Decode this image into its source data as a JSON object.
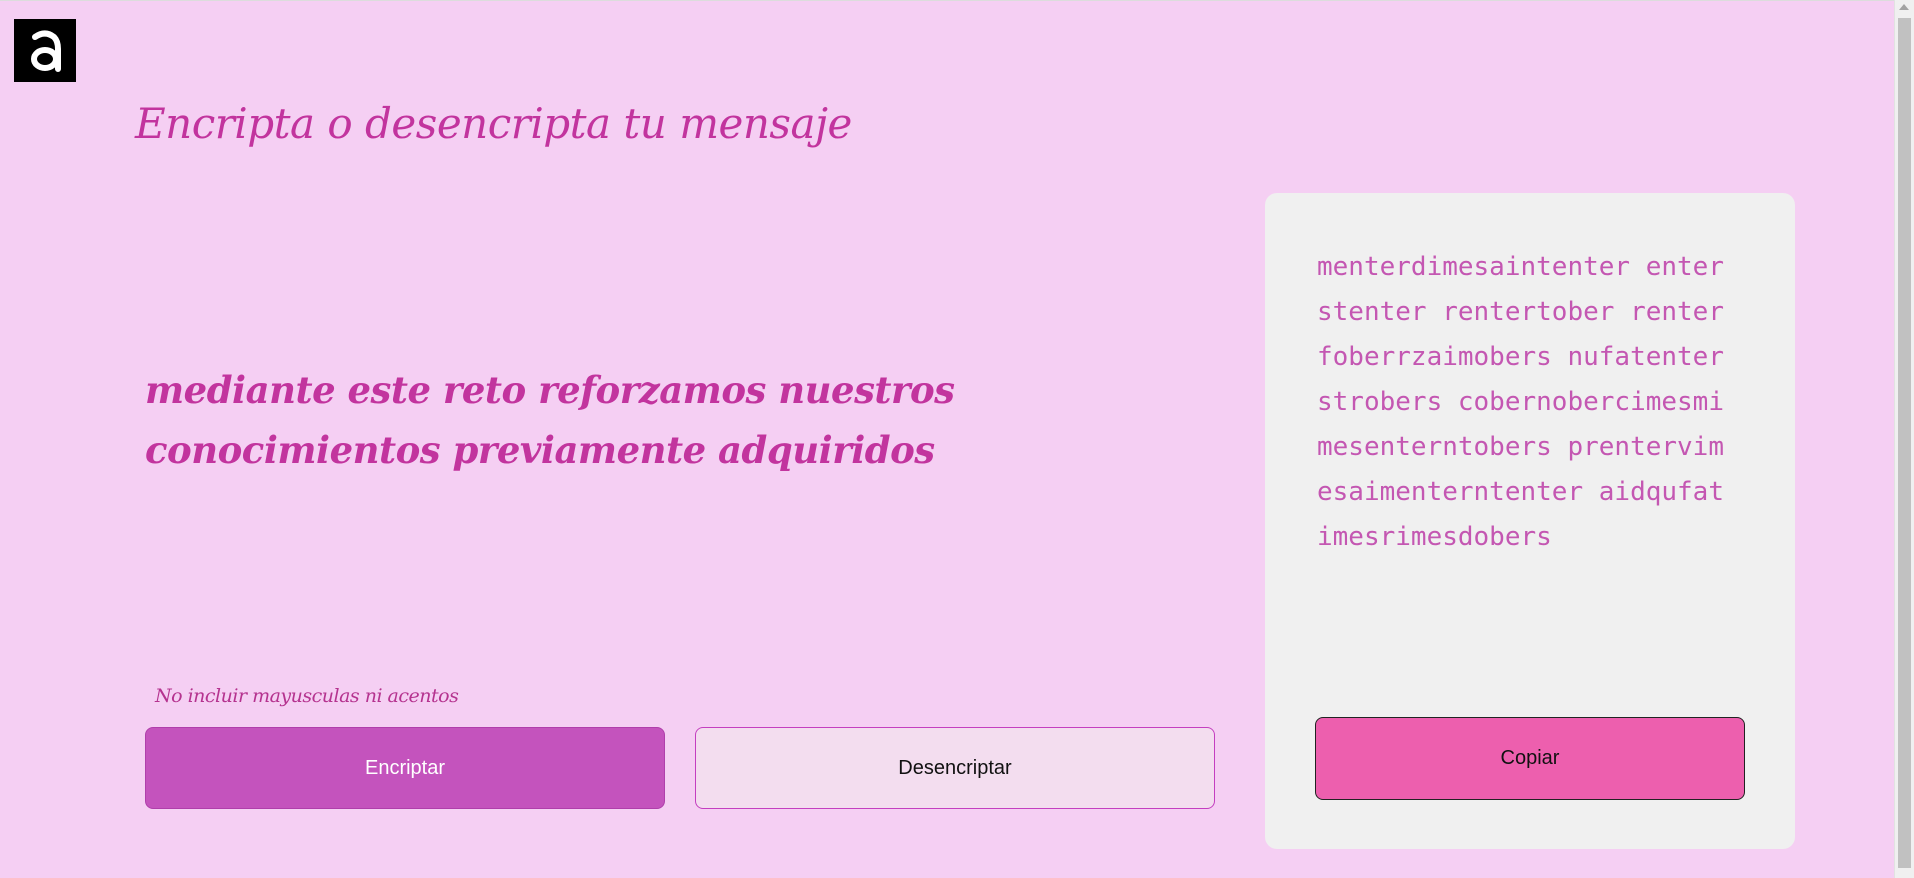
{
  "header": {
    "logo_icon": "alura-logo-icon",
    "title": "Encripta o desencripta tu mensaje"
  },
  "input": {
    "value": "mediante este reto reforzamos nuestros conocimientos previamente adquiridos",
    "hint": "No incluir mayusculas ni acentos"
  },
  "buttons": {
    "encrypt_label": "Encriptar",
    "decrypt_label": "Desencriptar",
    "copy_label": "Copiar"
  },
  "output": {
    "text": "menterdimesaintenter enterstenter rentertober renterfoberrzaimobers nufatenterstrobers cobernobercimesmimesenterntobers prentervimesaimenterntenter aidqufatimesrimesdobers"
  },
  "colors": {
    "background": "#f5cff3",
    "accent": "#c2349e",
    "encrypt_button": "#c453bd",
    "copy_button": "#ed5fae",
    "output_text": "#c457b2"
  }
}
